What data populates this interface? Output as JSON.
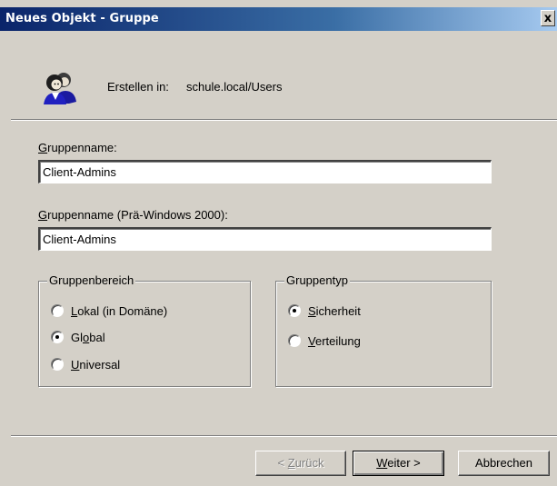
{
  "window": {
    "title": "Neues Objekt - Gruppe",
    "close_glyph": "x"
  },
  "header": {
    "icon": "users-group-icon",
    "create_label": "Erstellen in:",
    "create_path": "schule.local/Users"
  },
  "fields": {
    "group_name_label_accel": "G",
    "group_name_label_rest": "ruppenname:",
    "group_name_value": "Client-Admins",
    "group_name_pre2000_label_accel": "G",
    "group_name_pre2000_label_rest": "ruppenname (Prä-Windows 2000):",
    "group_name_pre2000_value": "Client-Admins"
  },
  "scope": {
    "legend": "Gruppenbereich",
    "options": [
      {
        "accel": "L",
        "rest": "okal (in Domäne)",
        "checked": false
      },
      {
        "pre": "Gl",
        "accel": "o",
        "rest": "bal",
        "checked": true
      },
      {
        "accel": "U",
        "rest": "niversal",
        "checked": false
      }
    ]
  },
  "type": {
    "legend": "Gruppentyp",
    "options": [
      {
        "accel": "S",
        "rest": "icherheit",
        "checked": true
      },
      {
        "accel": "V",
        "rest": "erteilung",
        "checked": false
      }
    ]
  },
  "buttons": {
    "back_prefix": "< ",
    "back_accel": "Z",
    "back_rest": "urück",
    "next_accel": "W",
    "next_rest": "eiter >",
    "cancel": "Abbrechen"
  }
}
